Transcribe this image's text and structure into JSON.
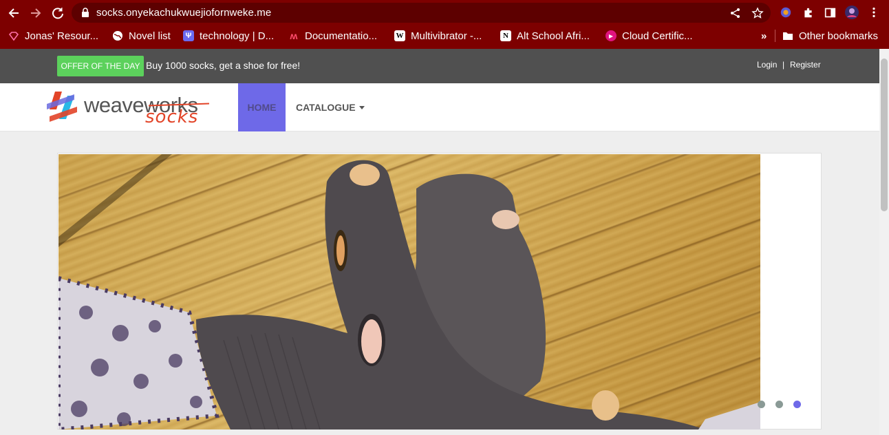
{
  "browser": {
    "url": "socks.onyekachukwuejiofornweke.me",
    "bookmarks": [
      {
        "label": "Jonas' Resour...",
        "icon": "diamond-icon",
        "color": "#ff6fa8"
      },
      {
        "label": "Novel list",
        "icon": "globe-icon",
        "color": "#ffffff"
      },
      {
        "label": "technology | D...",
        "icon": "trident-icon",
        "color": "#6a6af0"
      },
      {
        "label": "Documentatio...",
        "icon": "m-logo-icon",
        "color": "#ff4d6d"
      },
      {
        "label": "Multivibrator -...",
        "icon": "wikipedia-icon",
        "color": "#ffffff"
      },
      {
        "label": "Alt School Afri...",
        "icon": "notion-icon",
        "color": "#ffffff"
      },
      {
        "label": "Cloud Certific...",
        "icon": "play-circle-icon",
        "color": "#e0137f"
      }
    ],
    "overflow": "»",
    "other_bookmarks": "Other bookmarks"
  },
  "topbar": {
    "offer_label": "OFFER OF THE DAY",
    "offer_text": "Buy 1000 socks, get a shoe for free!",
    "login": "Login",
    "separator": "|",
    "register": "Register"
  },
  "logo": {
    "word": "weaveworks",
    "sub": "socks"
  },
  "nav": {
    "home": "HOME",
    "catalogue": "CATALOGUE"
  },
  "carousel": {
    "image_alt": "worn grey socks with holes on wooden deck",
    "slide_count": 3,
    "active_index": 2
  },
  "colors": {
    "chrome": "#7d0000",
    "accent": "#6e69e8",
    "offer": "#5cd15c",
    "topbar": "#505050"
  }
}
